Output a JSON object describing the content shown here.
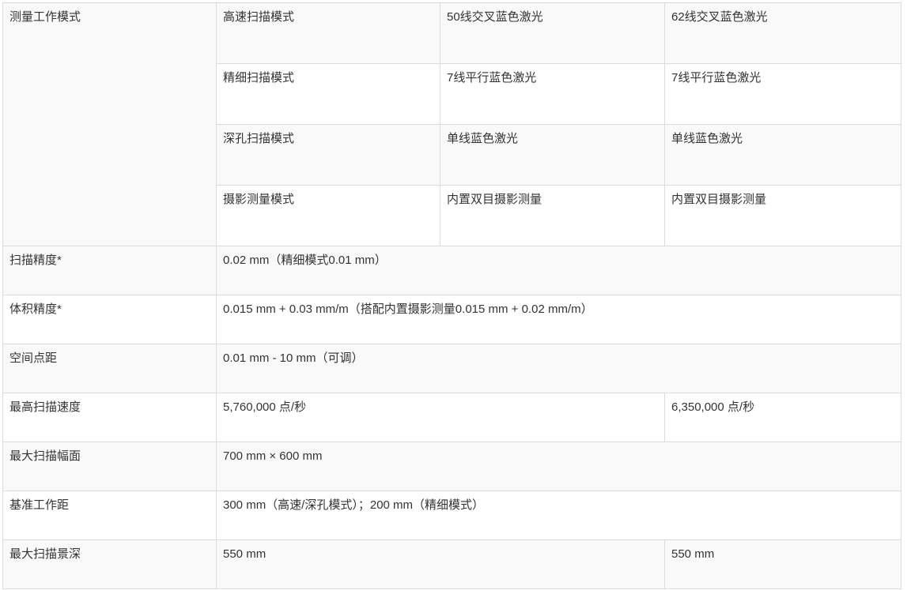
{
  "table": {
    "mode_label": "测量工作模式",
    "modes": [
      {
        "name": "高速扫描模式",
        "model_a": "50线交叉蓝色激光",
        "model_b": "62线交叉蓝色激光"
      },
      {
        "name": "精细扫描模式",
        "model_a": "7线平行蓝色激光",
        "model_b": "7线平行蓝色激光"
      },
      {
        "name": "深孔扫描模式",
        "model_a": "单线蓝色激光",
        "model_b": "单线蓝色激光"
      },
      {
        "name": "摄影测量模式",
        "model_a": "内置双目摄影测量",
        "model_b": "内置双目摄影测量"
      }
    ],
    "specs": {
      "scan_accuracy": {
        "label": "扫描精度*",
        "value": "0.02 mm（精细模式0.01 mm）"
      },
      "volumetric_accuracy": {
        "label": "体积精度*",
        "value": "0.015 mm + 0.03 mm/m（搭配内置摄影测量0.015 mm + 0.02 mm/m）"
      },
      "point_distance": {
        "label": "空间点距",
        "value": "0.01 mm - 10 mm（可调）"
      },
      "max_scan_speed": {
        "label": "最高扫描速度",
        "value_a": "5,760,000 点/秒",
        "value_b": "6,350,000 点/秒"
      },
      "max_scan_area": {
        "label": "最大扫描幅面",
        "value": "700 mm × 600 mm"
      },
      "standoff_distance": {
        "label": "基准工作距",
        "value": "300 mm（高速/深孔模式）；200 mm（精细模式）"
      },
      "depth_of_field": {
        "label": "最大扫描景深",
        "value_a": "550 mm",
        "value_b": "550 mm"
      }
    }
  }
}
